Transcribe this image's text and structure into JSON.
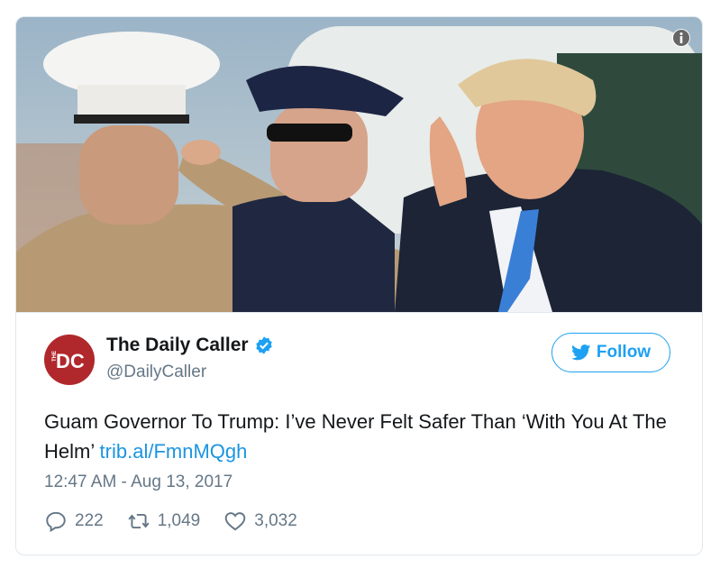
{
  "account": {
    "name": "The Daily Caller",
    "handle": "@DailyCaller",
    "avatar_letters": "DC",
    "avatar_small": "THE",
    "avatar_color": "#b0282c"
  },
  "follow_label": "Follow",
  "tweet": {
    "text": "Guam Governor To Trump: I’ve Never Felt Safer Than ‘With You At The Helm’",
    "link": "trib.al/FmnMQgh",
    "timestamp": "12:47 AM - Aug 13, 2017"
  },
  "stats": {
    "replies": "222",
    "retweets": "1,049",
    "likes": "3,032"
  },
  "colors": {
    "twitter_blue": "#1da1f2",
    "link_blue": "#1b95e0",
    "muted": "#657786",
    "text": "#14171a"
  },
  "icons": [
    "info-icon",
    "verified-icon",
    "twitter-bird-icon",
    "reply-icon",
    "retweet-icon",
    "like-icon"
  ]
}
